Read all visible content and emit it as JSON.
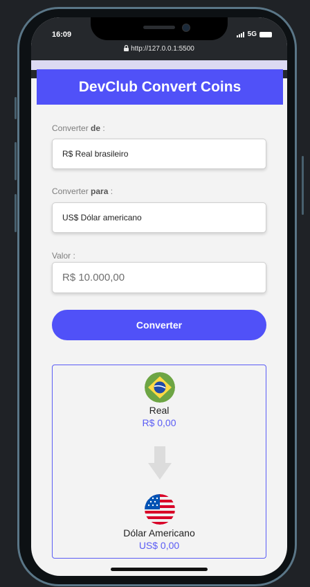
{
  "status": {
    "time": "16:09",
    "network": "5G",
    "url": "http://127.0.0.1:5500"
  },
  "header": {
    "title": "DevClub Convert Coins"
  },
  "form": {
    "from_label_prefix": "Converter ",
    "from_label_bold": "de",
    "from_label_suffix": " :",
    "from_value": "R$ Real brasileiro",
    "to_label_prefix": "Converter ",
    "to_label_bold": "para",
    "to_label_suffix": " :",
    "to_value": "US$ Dólar americano",
    "amount_label": "Valor :",
    "amount_placeholder": "R$ 10.000,00",
    "button_label": "Converter"
  },
  "result": {
    "from_name": "Real",
    "from_value": "R$ 0,00",
    "to_name": "Dólar Americano",
    "to_value": "US$ 0,00"
  },
  "colors": {
    "accent": "#5051f8",
    "value_text": "#5a5cf5"
  }
}
